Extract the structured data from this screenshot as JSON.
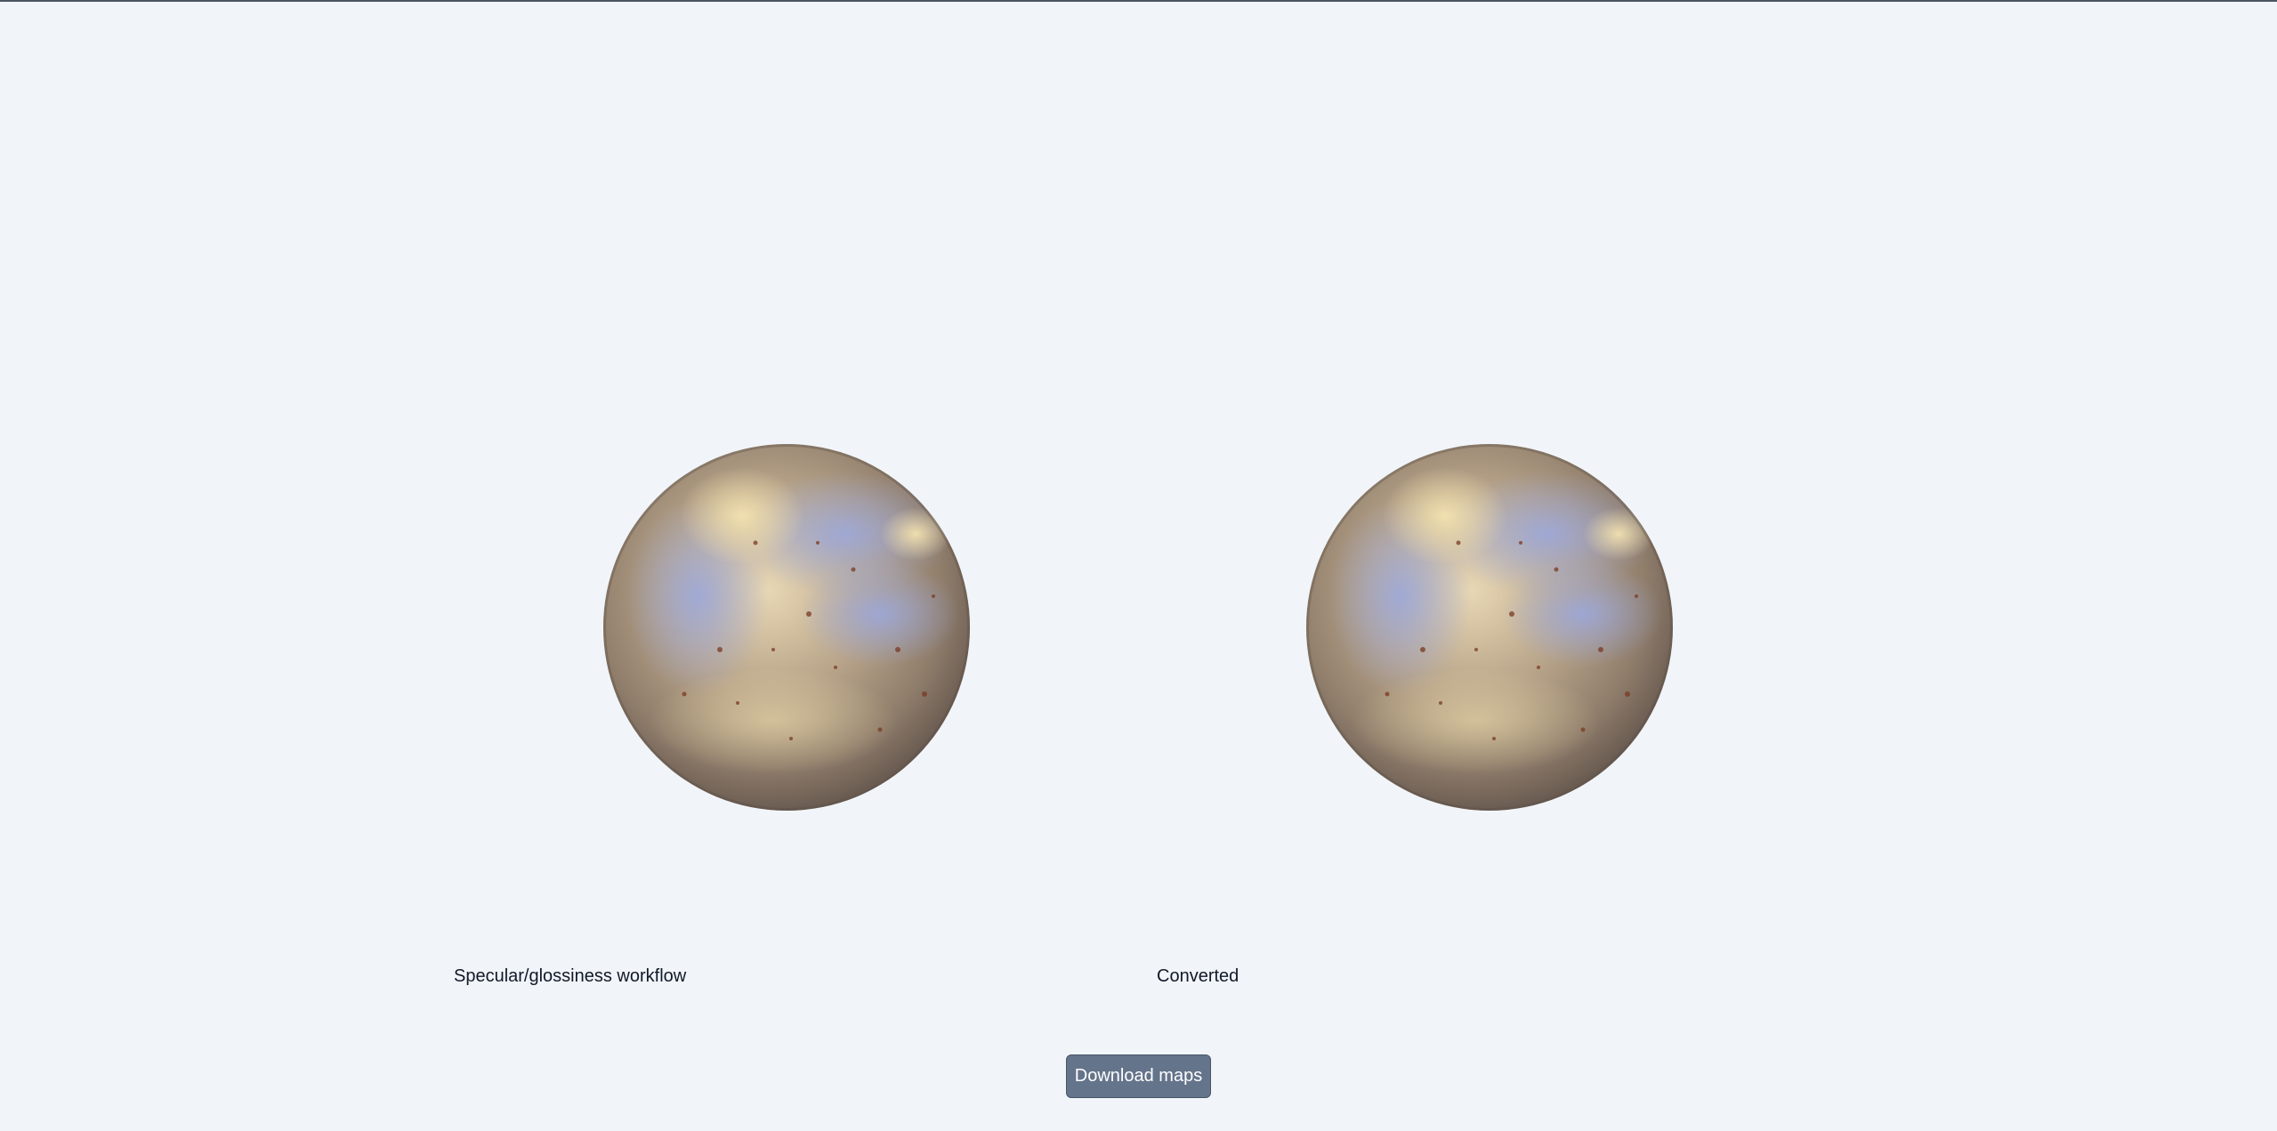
{
  "viewers": [
    {
      "label": "Specular/glossiness workflow"
    },
    {
      "label": "Converted"
    }
  ],
  "actions": {
    "download_label": "Download maps"
  },
  "colors": {
    "background": "#f1f5f9",
    "button": "#64748b",
    "button_text": "#ffffff",
    "label_text": "#111827"
  }
}
